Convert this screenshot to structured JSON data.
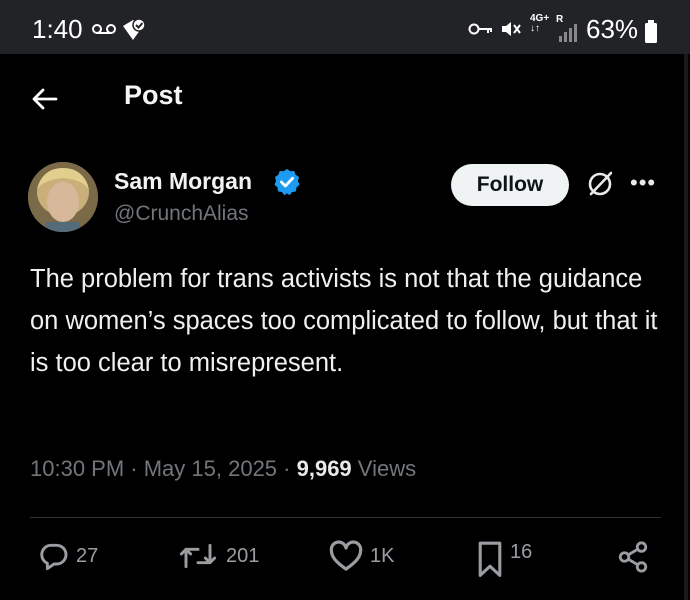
{
  "status_bar": {
    "time": "1:40",
    "network": "4G+",
    "roaming": "R",
    "battery_percent": "63%",
    "icons": [
      "voicemail-icon",
      "check-shield-icon",
      "vpn-key-icon",
      "mute-icon",
      "signal-icon",
      "battery-icon"
    ]
  },
  "header": {
    "title": "Post"
  },
  "post": {
    "author_name": "Sam Morgan",
    "author_handle": "@CrunchAlias",
    "verified": true,
    "follow_label": "Follow",
    "text": "The problem for trans activists is not that the guidance on women’s spaces too complicated to follow, but that it is too clear to misrepresent.",
    "time": "10:30 PM",
    "date": "May 15, 2025",
    "views_count": "9,969",
    "views_label": "Views"
  },
  "actions": {
    "replies": "27",
    "reposts": "201",
    "likes": "1K",
    "bookmarks": "16"
  },
  "colors": {
    "background": "#000000",
    "status_bar": "#222327",
    "text_secondary": "#71767b",
    "verified_blue": "#1d9bf0",
    "follow_bg": "#eff3f4"
  }
}
